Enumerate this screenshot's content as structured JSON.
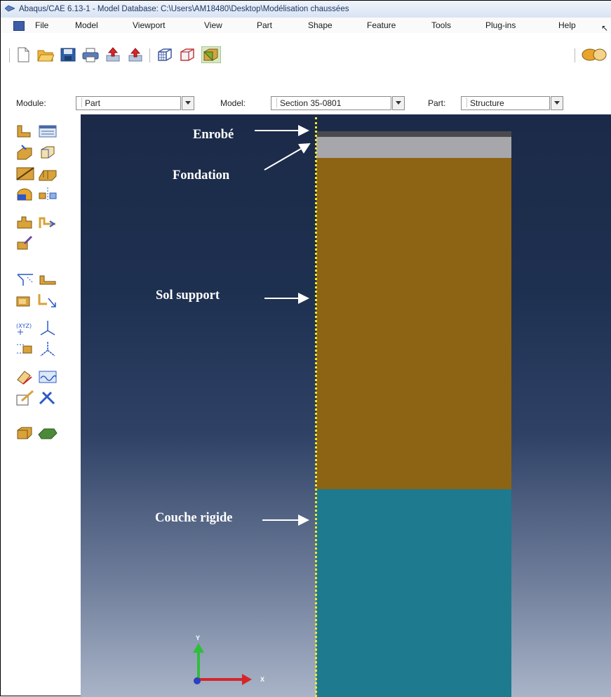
{
  "window": {
    "title": "Abaqus/CAE 6.13-1 - Model Database: C:\\Users\\AM18480\\Desktop\\Modélisation chaussées"
  },
  "menu": {
    "items": [
      "File",
      "Model",
      "Viewport",
      "View",
      "Part",
      "Shape",
      "Feature",
      "Tools",
      "Plug-ins",
      "Help"
    ]
  },
  "context": {
    "module_label": "Module:",
    "module_value": "Part",
    "model_label": "Model:",
    "model_value": "Section 35-0801",
    "part_label": "Part:",
    "part_value": "Structure"
  },
  "annotations": {
    "enrobe": "Enrobé",
    "fondation": "Fondation",
    "sol_support": "Sol support",
    "couche_rigide": "Couche rigide"
  },
  "axes": {
    "y": "Y",
    "x": "X"
  },
  "colors": {
    "viewport_top": "#1b2a48",
    "viewport_bottom": "#a9b4c8",
    "enrobe": "#4a4a4e",
    "fondation": "#a7a7ab",
    "sol_support": "#8d6414",
    "couche_rigide": "#1d7a8f",
    "section_line": "#f2ea21",
    "annotation_text": "#ffffff"
  },
  "icons": {
    "toolbar": [
      "new-file-icon",
      "open-folder-icon",
      "save-icon",
      "print-icon",
      "import-icon",
      "export-icon",
      "render-wireframe-icon",
      "render-hidden-icon",
      "render-shaded-icon",
      "query-icon"
    ],
    "toolbox": [
      "create-part-icon",
      "part-manager-icon",
      "extrude-solid-icon",
      "revolve-icon",
      "cut-extrude-icon",
      "sweep-icon",
      "blend-icon",
      "mirror-icon",
      "shell-icon",
      "wire-icon",
      "edit-sketch-icon",
      "partition-face-icon",
      "partition-cell-icon",
      "datum-point-icon",
      "datum-axis-icon",
      "datum-plane-icon",
      "datum-csys-icon",
      "repair-icon",
      "tool-set-icon",
      "mesh-icon",
      "query-tool-icon",
      "feature-manager-icon"
    ]
  }
}
